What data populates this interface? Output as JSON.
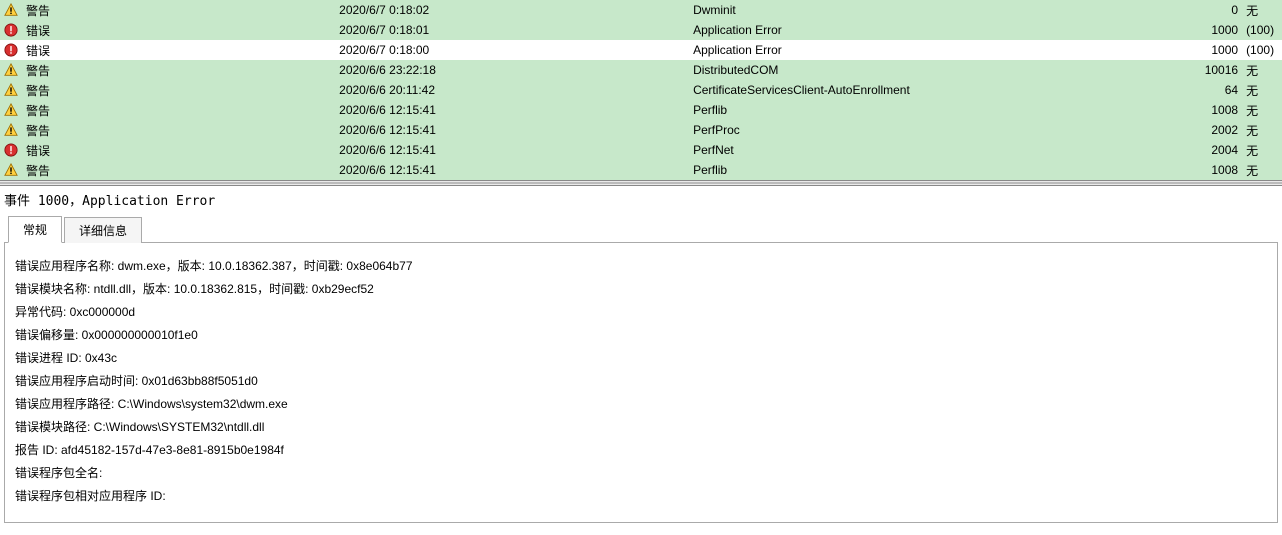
{
  "events": [
    {
      "level": "警告",
      "icon": "warning",
      "date": "2020/6/7 0:18:02",
      "source": "Dwminit",
      "id": "0",
      "task": "无",
      "selected": false
    },
    {
      "level": "错误",
      "icon": "error",
      "date": "2020/6/7 0:18:01",
      "source": "Application Error",
      "id": "1000",
      "task": "(100)",
      "selected": false
    },
    {
      "level": "错误",
      "icon": "error",
      "date": "2020/6/7 0:18:00",
      "source": "Application Error",
      "id": "1000",
      "task": "(100)",
      "selected": true
    },
    {
      "level": "警告",
      "icon": "warning",
      "date": "2020/6/6 23:22:18",
      "source": "DistributedCOM",
      "id": "10016",
      "task": "无",
      "selected": false
    },
    {
      "level": "警告",
      "icon": "warning",
      "date": "2020/6/6 20:11:42",
      "source": "CertificateServicesClient-AutoEnrollment",
      "id": "64",
      "task": "无",
      "selected": false
    },
    {
      "level": "警告",
      "icon": "warning",
      "date": "2020/6/6 12:15:41",
      "source": "Perflib",
      "id": "1008",
      "task": "无",
      "selected": false
    },
    {
      "level": "警告",
      "icon": "warning",
      "date": "2020/6/6 12:15:41",
      "source": "PerfProc",
      "id": "2002",
      "task": "无",
      "selected": false
    },
    {
      "level": "错误",
      "icon": "error",
      "date": "2020/6/6 12:15:41",
      "source": "PerfNet",
      "id": "2004",
      "task": "无",
      "selected": false
    },
    {
      "level": "警告",
      "icon": "warning",
      "date": "2020/6/6 12:15:41",
      "source": "Perflib",
      "id": "1008",
      "task": "无",
      "selected": false
    }
  ],
  "detail": {
    "header": "事件 1000，Application Error",
    "tabs": {
      "general": "常规",
      "details": "详细信息"
    },
    "lines": [
      "错误应用程序名称: dwm.exe，版本: 10.0.18362.387，时间戳: 0x8e064b77",
      "错误模块名称: ntdll.dll，版本: 10.0.18362.815，时间戳: 0xb29ecf52",
      "异常代码: 0xc000000d",
      "错误偏移量: 0x000000000010f1e0",
      "错误进程 ID: 0x43c",
      "错误应用程序启动时间: 0x01d63bb88f5051d0",
      "错误应用程序路径: C:\\Windows\\system32\\dwm.exe",
      "错误模块路径: C:\\Windows\\SYSTEM32\\ntdll.dll",
      "报告 ID: afd45182-157d-47e3-8e81-8915b0e1984f",
      "错误程序包全名:",
      "错误程序包相对应用程序 ID:"
    ]
  }
}
